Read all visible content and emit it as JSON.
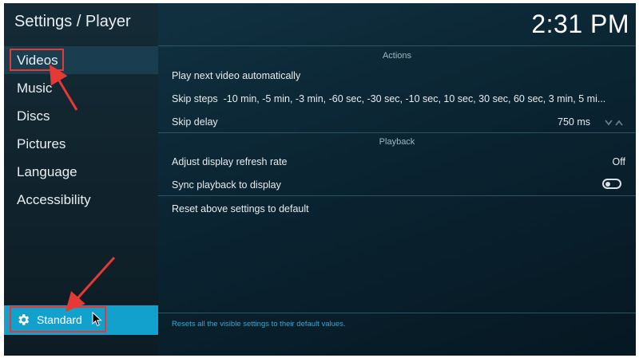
{
  "header": {
    "title": "Settings / Player",
    "clock": "2:31 PM"
  },
  "sidebar": {
    "items": [
      {
        "label": "Videos"
      },
      {
        "label": "Music"
      },
      {
        "label": "Discs"
      },
      {
        "label": "Pictures"
      },
      {
        "label": "Language"
      },
      {
        "label": "Accessibility"
      }
    ],
    "selected": "Videos",
    "level_button": {
      "label": "Standard",
      "icon": "gear-icon"
    }
  },
  "sections": {
    "actions": {
      "header": "Actions",
      "rows": [
        {
          "label": "Play next video automatically"
        },
        {
          "label": "Skip steps",
          "value": "-10 min, -5 min, -3 min, -60 sec, -30 sec, -10 sec, 10 sec, 30 sec, 60 sec, 3 min, 5 mi..."
        },
        {
          "label": "Skip delay",
          "value": "750 ms"
        }
      ]
    },
    "playback": {
      "header": "Playback",
      "rows": [
        {
          "label": "Adjust display refresh rate",
          "value": "Off"
        },
        {
          "label": "Sync playback to display",
          "toggle": false
        }
      ]
    },
    "reset": {
      "label": "Reset above settings to default"
    }
  },
  "footer": {
    "description": "Resets all the visible settings to their default values."
  },
  "colors": {
    "accent": "#12a0cc",
    "annotation": "#e53935"
  }
}
